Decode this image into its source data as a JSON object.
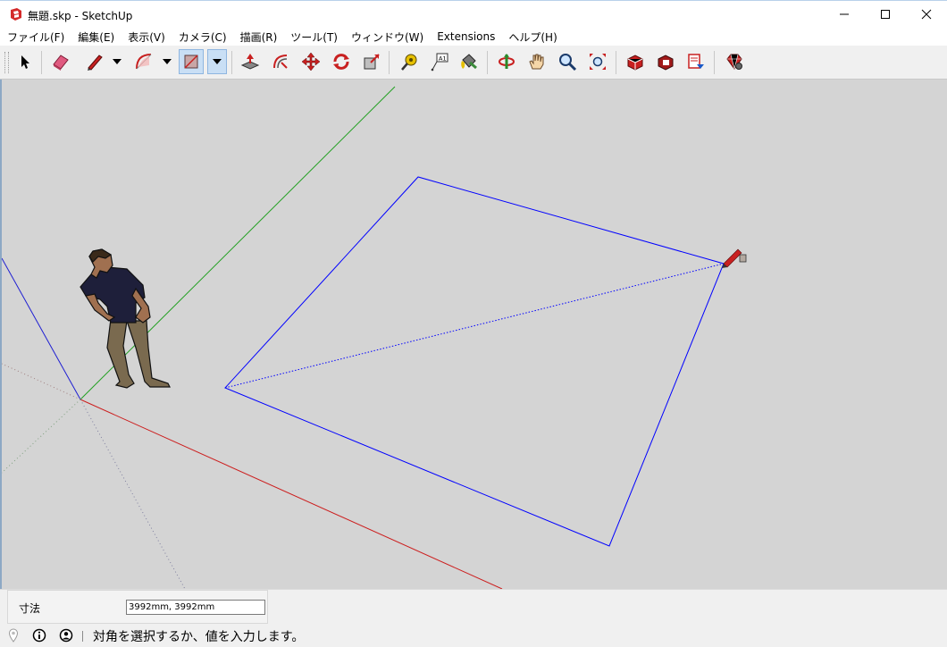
{
  "window": {
    "title": "無題.skp - SketchUp"
  },
  "menu": [
    {
      "label": "ファイル(F)"
    },
    {
      "label": "編集(E)"
    },
    {
      "label": "表示(V)"
    },
    {
      "label": "カメラ(C)"
    },
    {
      "label": "描画(R)"
    },
    {
      "label": "ツール(T)"
    },
    {
      "label": "ウィンドウ(W)"
    },
    {
      "label": "Extensions"
    },
    {
      "label": "ヘルプ(H)"
    }
  ],
  "toolbar": {
    "active_tool": "rectangle",
    "tools": [
      "select",
      "eraser",
      "line",
      "arc",
      "rectangle",
      "push-pull",
      "offset",
      "move",
      "rotate",
      "scale",
      "tape-measure",
      "text",
      "paint-bucket",
      "orbit",
      "pan",
      "zoom",
      "zoom-extents",
      "3d-warehouse",
      "extension-warehouse",
      "layout",
      "extension-manager"
    ]
  },
  "measurements": {
    "label": "寸法",
    "value": "3992mm, 3992mm"
  },
  "status": {
    "message": "対角を選択するか、値を入力します。"
  },
  "colors": {
    "viewport_background": "#d4d4d4",
    "red_axis": "#cc1e1e",
    "green_axis": "#21a021",
    "blue_axis": "#1e1ed2",
    "rectangle_edges": "#0000ff"
  }
}
